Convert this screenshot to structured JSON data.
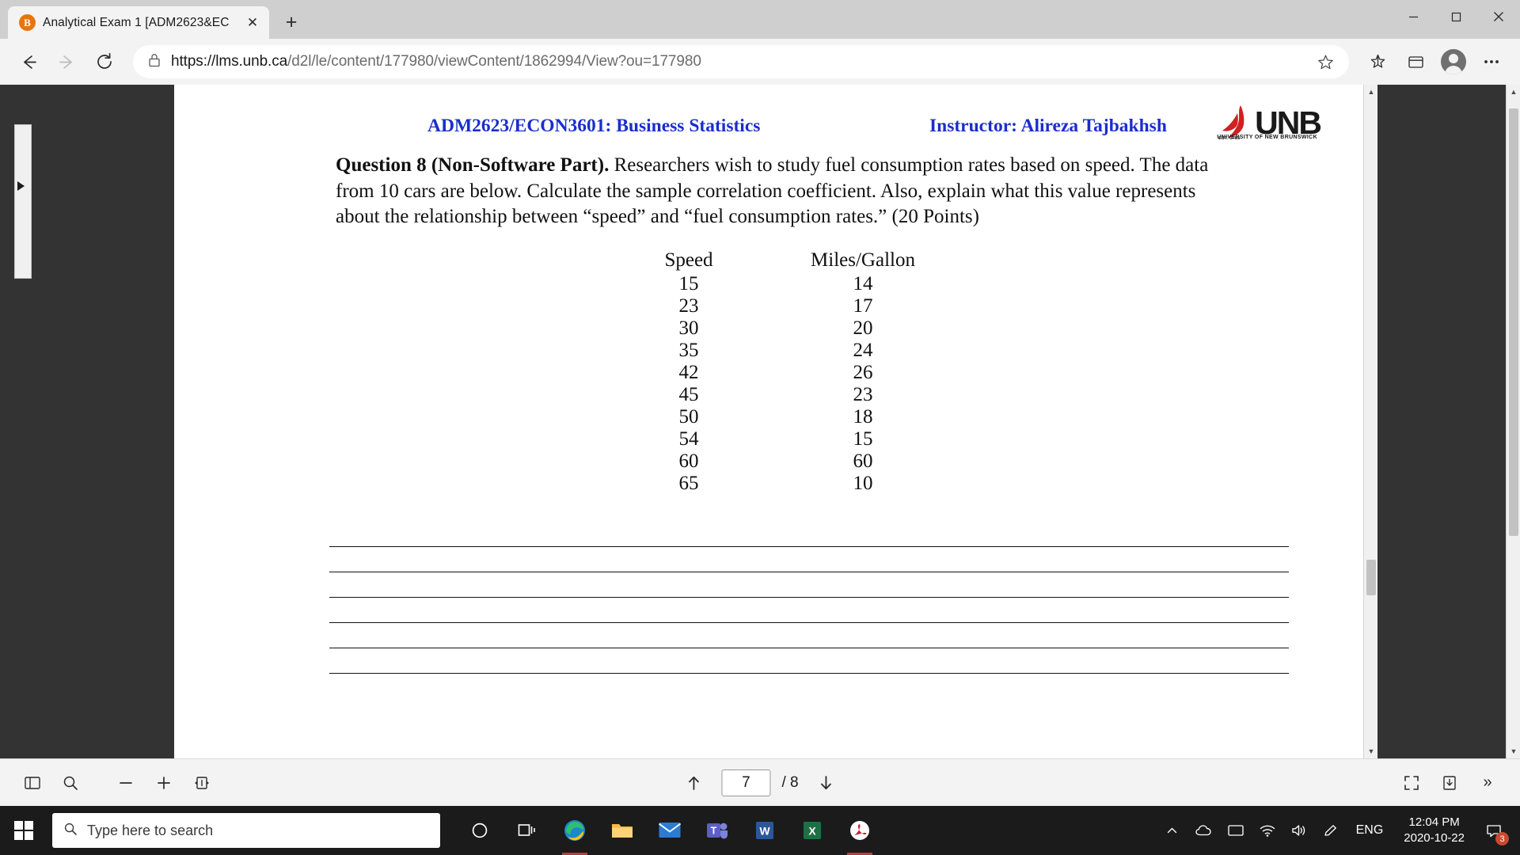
{
  "browser": {
    "tab": {
      "title": "Analytical Exam 1 [ADM2623&EC",
      "favicon": "B",
      "close_label": "✕"
    },
    "new_tab_label": "+",
    "window_controls": {
      "minimize": "─",
      "maximize": "❐",
      "close": "✕"
    },
    "toolbar": {
      "back_label": "←",
      "forward_label": "→",
      "refresh_label": "⟳",
      "lock_icon": "lock",
      "url_scheme": "https://",
      "url_host": "lms.unb.ca",
      "url_path": "/d2l/le/content/177980/viewContent/1862994/View?ou=177980",
      "url_full": "https://lms.unb.ca/d2l/le/content/177980/viewContent/1862994/View?ou=177980",
      "favorite_label": "☆",
      "collections_label": "✦",
      "addons_label": "⊞",
      "settings_label": "⋯"
    }
  },
  "document": {
    "header": {
      "course": "ADM2623/ECON3601: Business Statistics",
      "instructor": "Instructor: Alireza Tajbakhsh",
      "logo": {
        "word": "UNB",
        "est": "EST. 1785",
        "subtitle": "UNIVERSITY OF NEW BRUNSWICK",
        "sail_color": "#d02020"
      }
    },
    "question": {
      "label": "Question 8 (Non-Software Part).",
      "text": " Researchers wish to study fuel consumption rates based on speed. The data from 10 cars are below. Calculate the sample correlation coefficient. Also, explain what this value represents about the relationship between “speed” and “fuel consumption rates.” (20 Points)"
    },
    "table": {
      "headers": [
        "Speed",
        "Miles/Gallon"
      ],
      "rows": [
        [
          "15",
          "14"
        ],
        [
          "23",
          "17"
        ],
        [
          "30",
          "20"
        ],
        [
          "35",
          "24"
        ],
        [
          "42",
          "26"
        ],
        [
          "45",
          "23"
        ],
        [
          "50",
          "18"
        ],
        [
          "54",
          "15"
        ],
        [
          "60",
          "60"
        ],
        [
          "65",
          "10"
        ]
      ]
    },
    "answer_line_count": 6
  },
  "pdf_toolbar": {
    "sidebar_toggle_label": "◫",
    "search_label": "⚲",
    "zoom_out_label": "−",
    "zoom_in_label": "+",
    "fit_label": "⧉",
    "prev_page_label": "↑",
    "next_page_label": "↓",
    "current_page": "7",
    "page_total": "/ 8",
    "fit_page_label": "⛶",
    "save_label": "⤓",
    "more_label": "»"
  },
  "taskbar": {
    "start_label": "Start",
    "search_placeholder": "Type here to search",
    "apps": [
      {
        "name": "cortana",
        "glyph": "○"
      },
      {
        "name": "task-view",
        "glyph": "⧉"
      },
      {
        "name": "edge",
        "glyph": "e"
      },
      {
        "name": "file-explorer",
        "glyph": "🗀"
      },
      {
        "name": "mail",
        "glyph": "✉"
      },
      {
        "name": "teams",
        "glyph": "T"
      },
      {
        "name": "word",
        "glyph": "W"
      },
      {
        "name": "excel",
        "glyph": "X"
      },
      {
        "name": "acrobat",
        "glyph": "A"
      }
    ],
    "tray": {
      "chevron": "∧",
      "onedrive": "☁",
      "display": "▭",
      "network": "📶",
      "volume": "🔊",
      "pen": "✎",
      "language": "ENG",
      "time": "12:04 PM",
      "date": "2020-10-22",
      "notification_count": "3"
    }
  }
}
